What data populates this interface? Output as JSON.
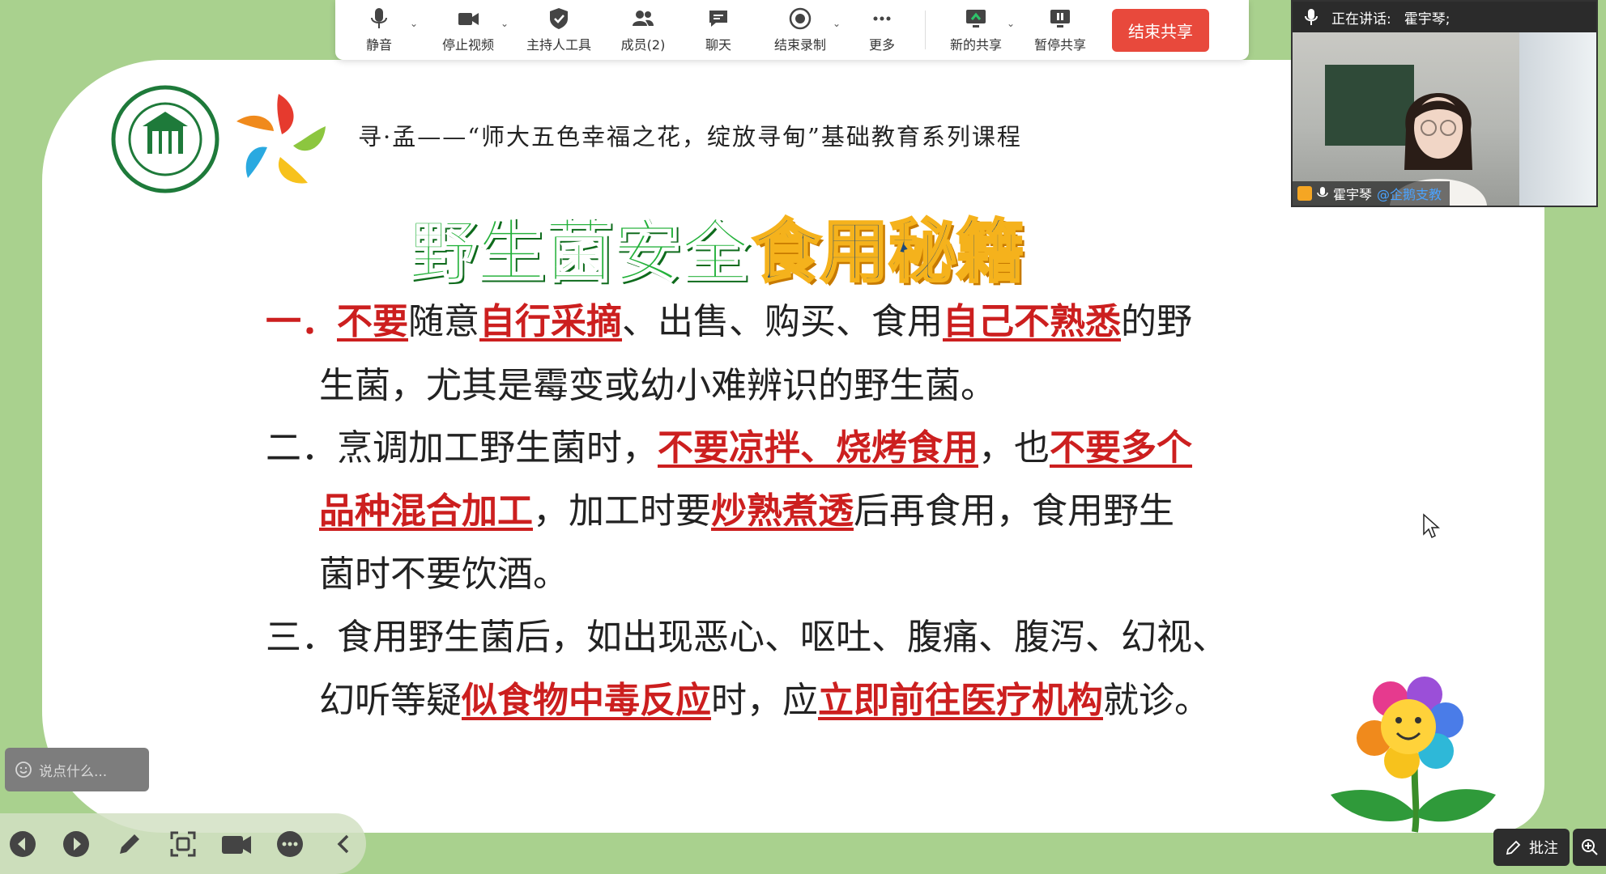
{
  "toolbar": {
    "items": [
      {
        "label": "静音",
        "icon": "microphone-icon",
        "caret": true
      },
      {
        "label": "停止视频",
        "icon": "video-camera-icon",
        "caret": true
      },
      {
        "label": "主持人工具",
        "icon": "shield-icon",
        "caret": false
      },
      {
        "label": "成员(2)",
        "icon": "members-icon",
        "caret": false
      },
      {
        "label": "聊天",
        "icon": "chat-icon",
        "caret": false
      },
      {
        "label": "结束录制",
        "icon": "record-icon",
        "caret": true
      },
      {
        "label": "更多",
        "icon": "more-icon",
        "caret": false
      },
      {
        "label": "新的共享",
        "icon": "new-share-icon",
        "caret": true
      },
      {
        "label": "暂停共享",
        "icon": "pause-share-icon",
        "caret": false
      }
    ],
    "end_share": "结束共享"
  },
  "video": {
    "speaking_label": "正在讲话:",
    "speaking_name": "霍宇琴;",
    "participant_name": "霍宇琴",
    "participant_org": "@企鹅支教"
  },
  "slide": {
    "header": "寻·孟——“师大五色幸福之花，绽放寻甸”基础教育系列课程",
    "title_part1": "野生菌安全",
    "title_part2": "食用秘籍",
    "items": [
      {
        "line1": [
          {
            "t": "一．",
            "style": "num1"
          },
          {
            "t": "不要",
            "style": "hl"
          },
          {
            "t": "随意",
            "style": ""
          },
          {
            "t": "自行采摘",
            "style": "hl"
          },
          {
            "t": "、出售、购买、食用",
            "style": ""
          },
          {
            "t": "自己不熟悉",
            "style": "hl"
          },
          {
            "t": "的野",
            "style": ""
          }
        ],
        "line2": [
          {
            "t": "生菌，尤其是霉变或幼小难辨识的野生菌。",
            "style": ""
          }
        ]
      },
      {
        "line1": [
          {
            "t": "二．烹调加工野生菌时，",
            "style": ""
          },
          {
            "t": "不要凉拌、烧烤食用",
            "style": "hl"
          },
          {
            "t": "，也",
            "style": ""
          },
          {
            "t": "不要多个",
            "style": "hl"
          }
        ],
        "line2": [
          {
            "t": "品种混合加工",
            "style": "hl"
          },
          {
            "t": "，加工时要",
            "style": ""
          },
          {
            "t": "炒熟煮透",
            "style": "hl"
          },
          {
            "t": "后再食用，食用野生",
            "style": ""
          }
        ],
        "line3": [
          {
            "t": "菌时不要饮酒。",
            "style": ""
          }
        ]
      },
      {
        "line1": [
          {
            "t": "三．食用野生菌后，如出现恶心、呕吐、腹痛、腹泻、幻视、",
            "style": ""
          }
        ],
        "line2": [
          {
            "t": "幻听等疑",
            "style": ""
          },
          {
            "t": "似食物中毒反应",
            "style": "hl"
          },
          {
            "t": "时，应",
            "style": ""
          },
          {
            "t": "立即前往医疗机构",
            "style": "hl"
          },
          {
            "t": "就诊。",
            "style": ""
          }
        ]
      }
    ]
  },
  "comment": {
    "placeholder": "说点什么..."
  },
  "annotate": {
    "label": "批注"
  },
  "bottom_icons": [
    "prev-icon",
    "next-icon",
    "pen-icon",
    "screenshot-icon",
    "camera-icon",
    "more-icon",
    "collapse-icon"
  ],
  "colors": {
    "background": "#a9d18e",
    "end_share": "#e8493c",
    "highlight": "#cc1f1f"
  }
}
